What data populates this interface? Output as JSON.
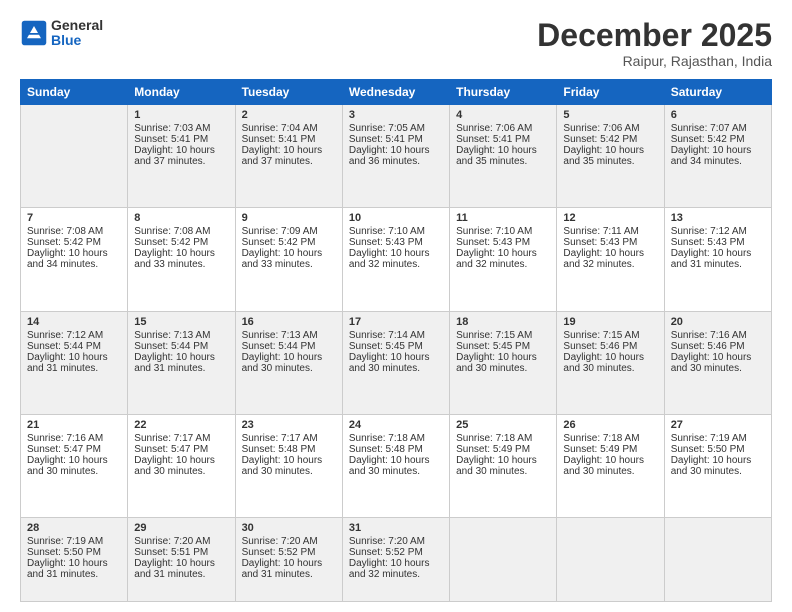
{
  "header": {
    "logo_general": "General",
    "logo_blue": "Blue",
    "month_title": "December 2025",
    "location": "Raipur, Rajasthan, India"
  },
  "days_of_week": [
    "Sunday",
    "Monday",
    "Tuesday",
    "Wednesday",
    "Thursday",
    "Friday",
    "Saturday"
  ],
  "weeks": [
    [
      {
        "day": "",
        "empty": true
      },
      {
        "day": "1",
        "sunrise": "7:03 AM",
        "sunset": "5:41 PM",
        "daylight": "10 hours and 37 minutes."
      },
      {
        "day": "2",
        "sunrise": "7:04 AM",
        "sunset": "5:41 PM",
        "daylight": "10 hours and 37 minutes."
      },
      {
        "day": "3",
        "sunrise": "7:05 AM",
        "sunset": "5:41 PM",
        "daylight": "10 hours and 36 minutes."
      },
      {
        "day": "4",
        "sunrise": "7:06 AM",
        "sunset": "5:41 PM",
        "daylight": "10 hours and 35 minutes."
      },
      {
        "day": "5",
        "sunrise": "7:06 AM",
        "sunset": "5:42 PM",
        "daylight": "10 hours and 35 minutes."
      },
      {
        "day": "6",
        "sunrise": "7:07 AM",
        "sunset": "5:42 PM",
        "daylight": "10 hours and 34 minutes."
      }
    ],
    [
      {
        "day": "7",
        "sunrise": "7:08 AM",
        "sunset": "5:42 PM",
        "daylight": "10 hours and 34 minutes."
      },
      {
        "day": "8",
        "sunrise": "7:08 AM",
        "sunset": "5:42 PM",
        "daylight": "10 hours and 33 minutes."
      },
      {
        "day": "9",
        "sunrise": "7:09 AM",
        "sunset": "5:42 PM",
        "daylight": "10 hours and 33 minutes."
      },
      {
        "day": "10",
        "sunrise": "7:10 AM",
        "sunset": "5:43 PM",
        "daylight": "10 hours and 32 minutes."
      },
      {
        "day": "11",
        "sunrise": "7:10 AM",
        "sunset": "5:43 PM",
        "daylight": "10 hours and 32 minutes."
      },
      {
        "day": "12",
        "sunrise": "7:11 AM",
        "sunset": "5:43 PM",
        "daylight": "10 hours and 32 minutes."
      },
      {
        "day": "13",
        "sunrise": "7:12 AM",
        "sunset": "5:43 PM",
        "daylight": "10 hours and 31 minutes."
      }
    ],
    [
      {
        "day": "14",
        "sunrise": "7:12 AM",
        "sunset": "5:44 PM",
        "daylight": "10 hours and 31 minutes."
      },
      {
        "day": "15",
        "sunrise": "7:13 AM",
        "sunset": "5:44 PM",
        "daylight": "10 hours and 31 minutes."
      },
      {
        "day": "16",
        "sunrise": "7:13 AM",
        "sunset": "5:44 PM",
        "daylight": "10 hours and 30 minutes."
      },
      {
        "day": "17",
        "sunrise": "7:14 AM",
        "sunset": "5:45 PM",
        "daylight": "10 hours and 30 minutes."
      },
      {
        "day": "18",
        "sunrise": "7:15 AM",
        "sunset": "5:45 PM",
        "daylight": "10 hours and 30 minutes."
      },
      {
        "day": "19",
        "sunrise": "7:15 AM",
        "sunset": "5:46 PM",
        "daylight": "10 hours and 30 minutes."
      },
      {
        "day": "20",
        "sunrise": "7:16 AM",
        "sunset": "5:46 PM",
        "daylight": "10 hours and 30 minutes."
      }
    ],
    [
      {
        "day": "21",
        "sunrise": "7:16 AM",
        "sunset": "5:47 PM",
        "daylight": "10 hours and 30 minutes."
      },
      {
        "day": "22",
        "sunrise": "7:17 AM",
        "sunset": "5:47 PM",
        "daylight": "10 hours and 30 minutes."
      },
      {
        "day": "23",
        "sunrise": "7:17 AM",
        "sunset": "5:48 PM",
        "daylight": "10 hours and 30 minutes."
      },
      {
        "day": "24",
        "sunrise": "7:18 AM",
        "sunset": "5:48 PM",
        "daylight": "10 hours and 30 minutes."
      },
      {
        "day": "25",
        "sunrise": "7:18 AM",
        "sunset": "5:49 PM",
        "daylight": "10 hours and 30 minutes."
      },
      {
        "day": "26",
        "sunrise": "7:18 AM",
        "sunset": "5:49 PM",
        "daylight": "10 hours and 30 minutes."
      },
      {
        "day": "27",
        "sunrise": "7:19 AM",
        "sunset": "5:50 PM",
        "daylight": "10 hours and 30 minutes."
      }
    ],
    [
      {
        "day": "28",
        "sunrise": "7:19 AM",
        "sunset": "5:50 PM",
        "daylight": "10 hours and 31 minutes."
      },
      {
        "day": "29",
        "sunrise": "7:20 AM",
        "sunset": "5:51 PM",
        "daylight": "10 hours and 31 minutes."
      },
      {
        "day": "30",
        "sunrise": "7:20 AM",
        "sunset": "5:52 PM",
        "daylight": "10 hours and 31 minutes."
      },
      {
        "day": "31",
        "sunrise": "7:20 AM",
        "sunset": "5:52 PM",
        "daylight": "10 hours and 32 minutes."
      },
      {
        "day": "",
        "empty": true
      },
      {
        "day": "",
        "empty": true
      },
      {
        "day": "",
        "empty": true
      }
    ]
  ]
}
